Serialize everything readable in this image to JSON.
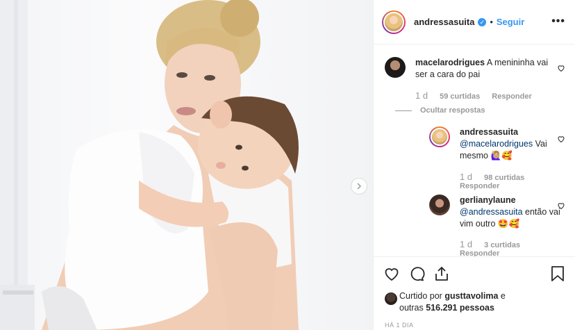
{
  "header": {
    "username": "andressasuita",
    "follow_label": "Seguir",
    "separator": "•",
    "more": "•••"
  },
  "comments": [
    {
      "username": "macelarodrigues",
      "text": "A menininha vai ser a cara do pai",
      "time": "1 d",
      "likes": "59 curtidas",
      "reply": "Responder",
      "hide_replies": "Ocultar respostas"
    }
  ],
  "replies": [
    {
      "username": "andressasuita",
      "mention": "@macelarodrigues",
      "text": "Vai mesmo 🙋🏼‍♀️🥰",
      "time": "1 d",
      "likes": "98 curtidas",
      "reply": "Responder"
    },
    {
      "username": "gerlianylaune",
      "mention": "@andressasuita",
      "text": "então vai vim outro 🤩🥰",
      "time": "1 d",
      "likes": "3 curtidas",
      "reply": "Responder"
    }
  ],
  "likes": {
    "prefix": "Curtido por",
    "user": "gusttavolima",
    "suffix": "e",
    "others_prefix": "outras",
    "count": "516.291 pessoas"
  },
  "posted": "HÁ 1 DIA",
  "icons": [
    "heart-icon",
    "comment-icon",
    "share-icon",
    "bookmark-icon",
    "chevron-right-icon",
    "verified-icon"
  ],
  "colors": {
    "accent": "#3897f0",
    "muted": "#999999",
    "text": "#262626"
  }
}
